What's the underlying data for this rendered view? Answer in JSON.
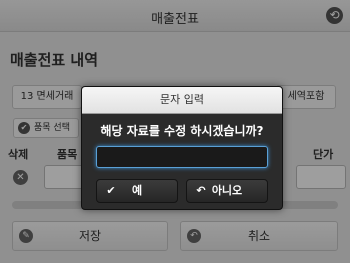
{
  "header": {
    "title": "매출전표"
  },
  "page": {
    "section_title": "매출전표 내역",
    "tax_left": "13 면세거래",
    "tax_right": "세역포함",
    "item_select_label": "품목 선택",
    "columns": {
      "delete": "삭제",
      "item": "품목",
      "price": "단가"
    },
    "buttons": {
      "save": "저장",
      "cancel": "취소"
    }
  },
  "dialog": {
    "title": "문자 입력",
    "message": "해당 자료를 수정 하시겠습니까?",
    "input_value": "",
    "yes_label": "예",
    "no_label": "아니오"
  }
}
